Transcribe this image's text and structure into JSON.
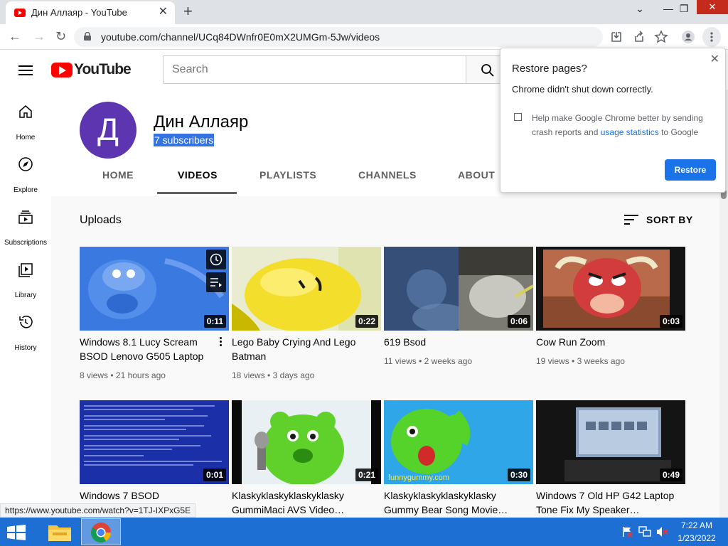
{
  "browser": {
    "tab_title": "Дин Аллаяр - YouTube",
    "url": "youtube.com/channel/UCq84DWnfr0E0mX2UMGm-5Jw/videos",
    "status_url": "https://www.youtube.com/watch?v=1TJ-IXPxG5E"
  },
  "yt": {
    "logo_text": "YouTube",
    "search_placeholder": "Search",
    "guide": [
      {
        "label": "Home",
        "icon": "home-icon"
      },
      {
        "label": "Explore",
        "icon": "compass-icon"
      },
      {
        "label": "Subscriptions",
        "icon": "subscriptions-icon"
      },
      {
        "label": "Library",
        "icon": "library-icon"
      },
      {
        "label": "History",
        "icon": "history-icon"
      }
    ]
  },
  "channel": {
    "avatar_letter": "Д",
    "name": "Дин Аллаяр",
    "subscribers": "7 subscribers",
    "tabs": [
      "HOME",
      "VIDEOS",
      "PLAYLISTS",
      "CHANNELS",
      "ABOUT"
    ],
    "active_tab": "VIDEOS"
  },
  "uploads": {
    "title": "Uploads",
    "sort_label": "SORT BY",
    "videos": [
      {
        "title": "Windows 8.1 Lucy Scream BSOD Lenovo G505 Laptop",
        "duration": "0:11",
        "views": "8 views",
        "age": "21 hours ago"
      },
      {
        "title": "Lego Baby Crying And Lego Batman",
        "duration": "0:22",
        "views": "18 views",
        "age": "3 days ago"
      },
      {
        "title": "619 Bsod",
        "duration": "0:06",
        "views": "11 views",
        "age": "2 weeks ago"
      },
      {
        "title": "Cow Run Zoom",
        "duration": "0:03",
        "views": "19 views",
        "age": "3 weeks ago"
      },
      {
        "title": "Windows 7 BSOD",
        "duration": "0:01",
        "views": "",
        "age": ""
      },
      {
        "title": "Klaskyklaskyklaskyklasky GummiMaci AVS Video…",
        "duration": "0:21",
        "views": "",
        "age": ""
      },
      {
        "title": "Klaskyklaskyklaskyklasky Gummy Bear Song Movie…",
        "duration": "0:30",
        "views": "",
        "age": ""
      },
      {
        "title": "Windows 7 Old HP G42 Laptop Tone Fix My Speaker…",
        "duration": "0:49",
        "views": "",
        "age": ""
      }
    ],
    "thumb_watermark": "funnygummy.com"
  },
  "popup": {
    "title": "Restore pages?",
    "message": "Chrome didn't shut down correctly.",
    "help_pre": "Help make Google Chrome better by sending crash reports and ",
    "help_link": "usage statistics",
    "help_post": " to Google",
    "button": "Restore"
  },
  "taskbar": {
    "time": "7:22 AM",
    "date": "1/23/2022"
  },
  "colors": {
    "yt_red": "#ff0000",
    "avatar": "#5e35b1",
    "chrome_blue": "#1a73e8",
    "taskbar": "#1e6fd3"
  }
}
